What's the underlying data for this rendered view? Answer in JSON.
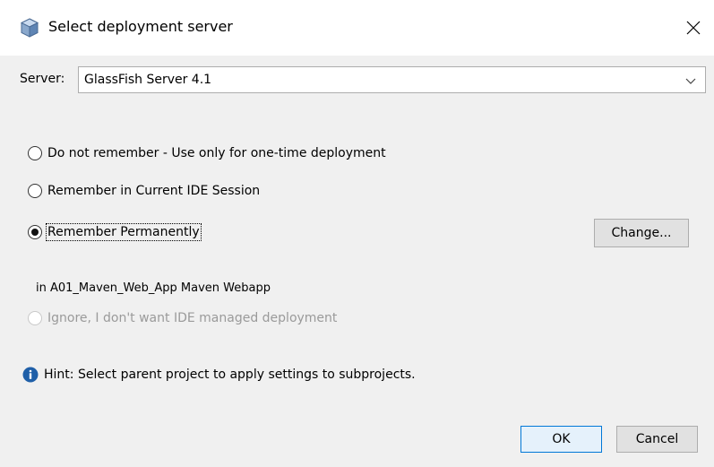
{
  "window": {
    "title": "Select deployment server",
    "icon": "app-cube-icon",
    "close_icon": "close-icon"
  },
  "server": {
    "label": "Server:",
    "selected": "GlassFish Server 4.1",
    "dropdown_icon": "chevron-down-icon"
  },
  "options": [
    {
      "label": "Do not remember - Use only for one-time deployment",
      "checked": false,
      "enabled": true
    },
    {
      "label": "Remember in Current IDE Session",
      "checked": false,
      "enabled": true
    },
    {
      "label": "Remember Permanently",
      "checked": true,
      "enabled": true
    },
    {
      "label": "Ignore, I don't want IDE managed deployment",
      "checked": false,
      "enabled": false
    }
  ],
  "change_button": {
    "label": "Change..."
  },
  "project_text": "in A01_Maven_Web_App Maven Webapp",
  "hint": {
    "icon": "info-icon",
    "text": "Hint: Select parent project to apply settings to subprojects."
  },
  "buttons": {
    "ok": "OK",
    "cancel": "Cancel"
  },
  "colors": {
    "accent": "#0078d7",
    "info_icon": "#1f5fa8"
  }
}
